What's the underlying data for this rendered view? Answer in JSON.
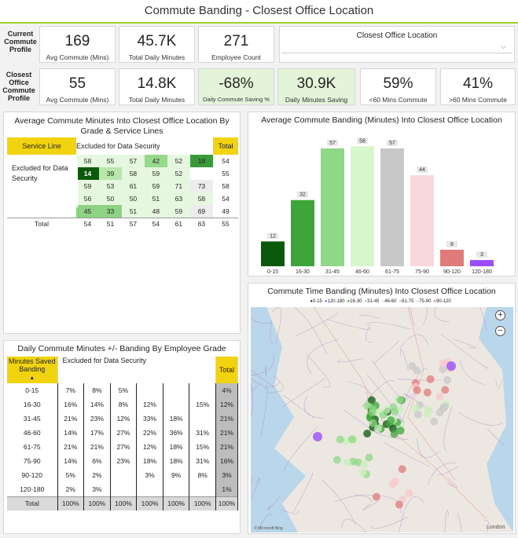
{
  "title": "Commute Banding - Closest Office Location",
  "current_profile_label": "Current Commute Profile",
  "closest_profile_label": "Closest Office Commute Profile",
  "current_cards": [
    {
      "value": "169",
      "label": "Avg Commute (Mins)"
    },
    {
      "value": "45.7K",
      "label": "Total Daily Minutes"
    },
    {
      "value": "271",
      "label": "Employee Count"
    }
  ],
  "slicer": {
    "title": "Closest Office Location",
    "chevron": "⌵"
  },
  "closest_cards": [
    {
      "value": "55",
      "label": "Avg Commute (Mins)",
      "highlight": false
    },
    {
      "value": "14.8K",
      "label": "Total Daily Minutes",
      "highlight": false
    },
    {
      "value": "-68%",
      "label": "Daily Commute Saving %",
      "highlight": true
    },
    {
      "value": "30.9K",
      "label": "Daily Minutes Saving",
      "highlight": true
    },
    {
      "value": "59%",
      "label": "<60 Mins Commute",
      "highlight": false
    },
    {
      "value": "41%",
      "label": ">60 Mins Commute",
      "highlight": false
    }
  ],
  "grade_table": {
    "title": "Average Commute Minutes Into Closest Office Location By Grade & Service Lines",
    "header_first": "Service Line",
    "header_middle": "Excluded for Data Security",
    "header_total": "Total",
    "row_overlay": "Excluded for Data Security",
    "rows": [
      {
        "cells": [
          "58",
          "55",
          "57",
          "42",
          "52",
          "18"
        ],
        "total": "54"
      },
      {
        "cells": [
          "14",
          "39",
          "58",
          "59",
          "52",
          ""
        ],
        "total": "55"
      },
      {
        "cells": [
          "59",
          "53",
          "61",
          "59",
          "71",
          "73"
        ],
        "total": "58"
      },
      {
        "cells": [
          "56",
          "50",
          "50",
          "51",
          "63",
          "58"
        ],
        "total": "54"
      },
      {
        "cells": [
          "45",
          "33",
          "51",
          "48",
          "59",
          "69"
        ],
        "total": "49"
      }
    ],
    "total_row": {
      "label": "Total",
      "cells": [
        "54",
        "51",
        "57",
        "54",
        "61",
        "63"
      ],
      "total": "55"
    },
    "cell_colors": [
      [
        "#e6f7df",
        "#e6f7df",
        "#e6f7df",
        "#97d98a",
        "#e6f7df",
        "#3a9a3a"
      ],
      [
        "#0b5a0b",
        "#b8e7ac",
        "#e6f7df",
        "#e6f7df",
        "#e6f7df",
        "#ffffff"
      ],
      [
        "#e6f7df",
        "#e6f7df",
        "#e6f7df",
        "#e6f7df",
        "#e6f7df",
        "#ececec"
      ],
      [
        "#e6f7df",
        "#e6f7df",
        "#e6f7df",
        "#e6f7df",
        "#e6f7df",
        "#e6f7df"
      ],
      [
        "#8ed283",
        "#8ed283",
        "#e6f7df",
        "#e6f7df",
        "#e6f7df",
        "#ececec"
      ]
    ]
  },
  "banding_table": {
    "title": "Daily Commute Minutes +/- Banding By Employee Grade",
    "header_first": "Minutes Saved Banding",
    "header_middle": "Excluded for Data Security",
    "header_total": "Total",
    "rows": [
      {
        "band": "0-15",
        "cells": [
          "7%",
          "8%",
          "5%",
          "",
          "",
          ""
        ],
        "total": "4%"
      },
      {
        "band": "16-30",
        "cells": [
          "16%",
          "14%",
          "8%",
          "12%",
          "",
          "15%"
        ],
        "total": "12%"
      },
      {
        "band": "31-45",
        "cells": [
          "21%",
          "23%",
          "12%",
          "33%",
          "18%",
          ""
        ],
        "total": "21%"
      },
      {
        "band": "46-60",
        "cells": [
          "14%",
          "17%",
          "27%",
          "22%",
          "36%",
          "31%"
        ],
        "total": "21%"
      },
      {
        "band": "61-75",
        "cells": [
          "21%",
          "21%",
          "27%",
          "12%",
          "18%",
          "15%"
        ],
        "total": "21%"
      },
      {
        "band": "75-90",
        "cells": [
          "14%",
          "6%",
          "23%",
          "18%",
          "18%",
          "31%"
        ],
        "total": "16%"
      },
      {
        "band": "90-120",
        "cells": [
          "5%",
          "2%",
          "",
          "3%",
          "9%",
          "8%"
        ],
        "total": "3%"
      },
      {
        "band": "120-180",
        "cells": [
          "2%",
          "3%",
          "",
          "",
          "",
          ""
        ],
        "total": "1%"
      }
    ],
    "total_row": {
      "label": "Total",
      "cells": [
        "100%",
        "100%",
        "100%",
        "100%",
        "100%",
        "100%"
      ],
      "total": "100%"
    }
  },
  "chart_data": {
    "type": "bar",
    "title": "Average Commute Banding (Minutes) Into Closest Office Location",
    "categories": [
      "0-15",
      "16-30",
      "31-45",
      "46-60",
      "61-75",
      "75-90",
      "90-120",
      "120-180"
    ],
    "values": [
      12,
      32,
      57,
      58,
      57,
      44,
      8,
      3
    ],
    "colors": [
      "#0b5a0b",
      "#3ea53a",
      "#8fd886",
      "#d6f7cc",
      "#c8c8c8",
      "#f8d8dc",
      "#e07b7b",
      "#9b4dff"
    ],
    "ylim": [
      0,
      60
    ],
    "xlabel": "",
    "ylabel": ""
  },
  "map": {
    "title": "Commute Time Banding (Minutes) Into Closest Office Location",
    "legend": [
      "0-15",
      "120-180",
      "16-30",
      "31-45",
      "46-60",
      "61-75",
      "75-90",
      "90-120"
    ],
    "legend_colors": [
      "#0b5a0b",
      "#9b4dff",
      "#3ea53a",
      "#8fd886",
      "#c8f0bc",
      "#c8c8c8",
      "#f8c8cc",
      "#e07b7b"
    ],
    "zoom_in": "+",
    "zoom_out": "−",
    "city_label": "London",
    "attribution": "© Microsoft Bing"
  }
}
